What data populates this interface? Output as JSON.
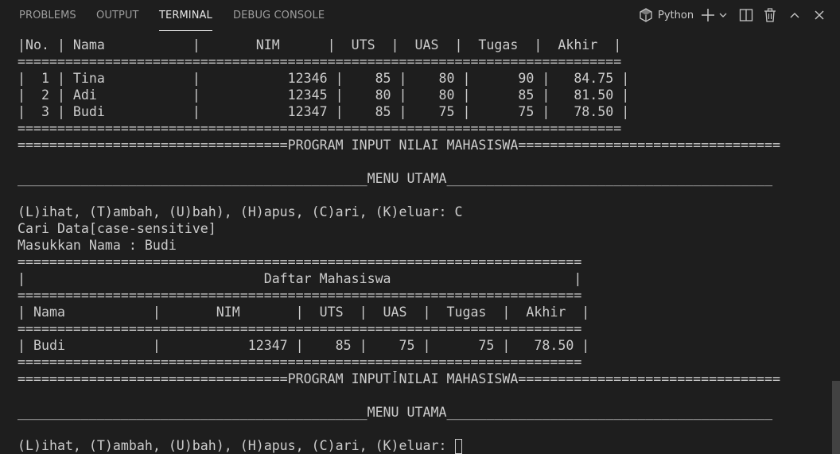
{
  "panel": {
    "tabs": [
      {
        "label": "PROBLEMS",
        "active": false
      },
      {
        "label": "OUTPUT",
        "active": false
      },
      {
        "label": "TERMINAL",
        "active": true
      },
      {
        "label": "DEBUG CONSOLE",
        "active": false
      }
    ],
    "terminal_profile": "Python",
    "toolbar_icons": [
      "python-icon",
      "plus-icon",
      "chevron-down-icon",
      "split-icon",
      "trash-icon",
      "chevron-up-icon",
      "close-icon"
    ]
  },
  "terminal": {
    "lines": [
      "|No. | Nama           |       NIM      |  UTS  |  UAS  |  Tugas  |  Akhir  |",
      "============================================================================",
      "|  1 | Tina           |           12346 |    85 |    80 |      90 |   84.75 |",
      "|  2 | Adi            |           12345 |    80 |    80 |      85 |   81.50 |",
      "|  3 | Budi           |           12347 |    85 |    75 |      75 |   78.50 |",
      "============================================================================",
      "==================================PROGRAM INPUT NILAI MAHASISWA=================================",
      "",
      "____________________________________________MENU UTAMA_________________________________________",
      "",
      "(L)ihat, (T)ambah, (U)bah), (H)apus, (C)ari, (K)eluar: C",
      "Cari Data[case-sensitive]",
      "Masukkan Nama : Budi",
      "=======================================================================",
      "|                              Daftar Mahasiswa                       |",
      "=======================================================================",
      "| Nama           |       NIM       |  UTS  |  UAS  |  Tugas  |  Akhir  |",
      "=======================================================================",
      "| Budi           |           12347 |    85 |    75 |      75 |   78.50 |",
      "=======================================================================",
      "==================================PROGRAM INPUT NILAI MAHASISWA=================================",
      "",
      "____________________________________________MENU UTAMA_________________________________________",
      "",
      "(L)ihat, (T)ambah, (U)bah), (H)apus, (C)ari, (K)eluar: "
    ]
  }
}
